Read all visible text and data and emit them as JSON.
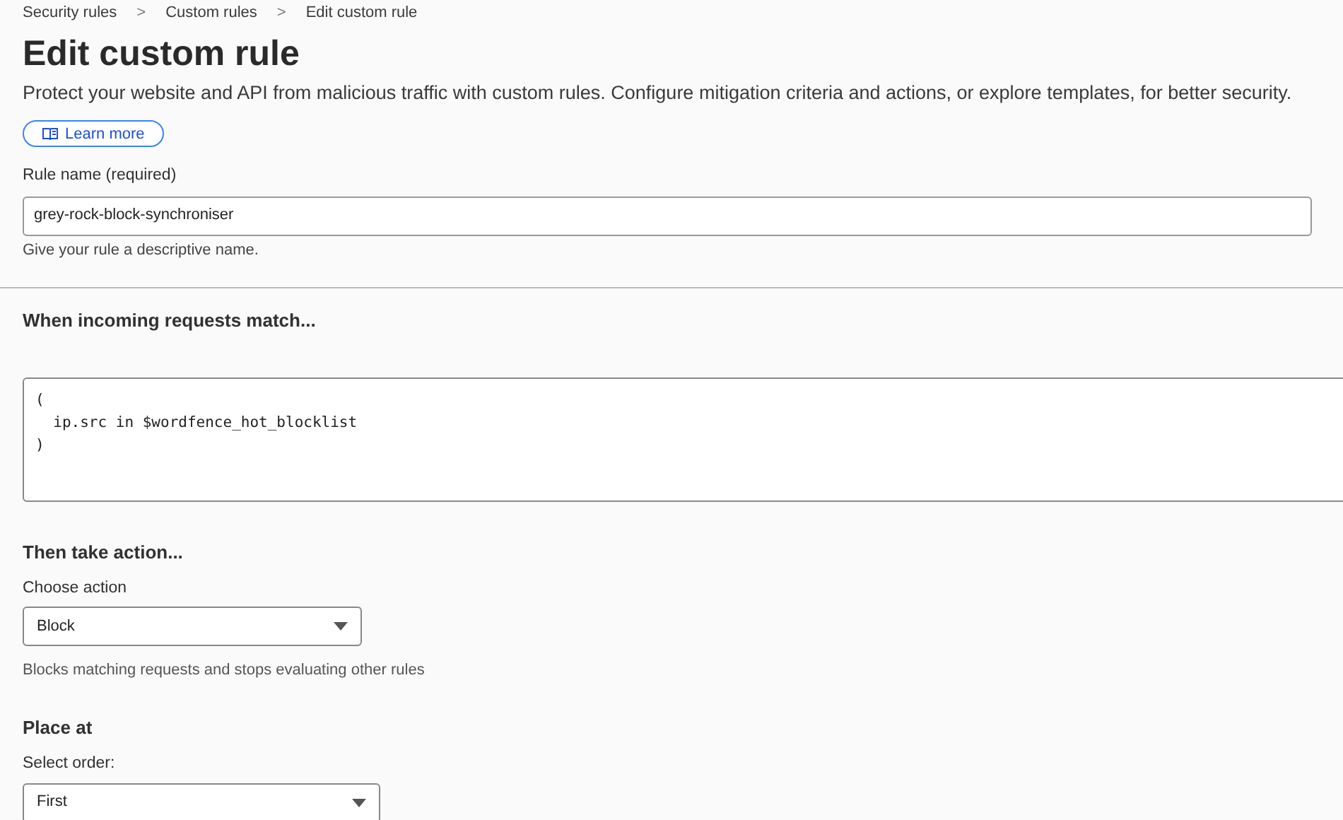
{
  "breadcrumbs": [
    {
      "label": "Security rules"
    },
    {
      "label": "Custom rules"
    },
    {
      "label": "Edit custom rule"
    }
  ],
  "breadcrumb_separator": ">",
  "title": "Edit custom rule",
  "description": "Protect your website and API from malicious traffic with custom rules. Configure mitigation criteria and actions, or explore templates, for better security.",
  "learn_more": "Learn more",
  "rule_name": {
    "label": "Rule name (required)",
    "value": "grey-rock-block-synchroniser",
    "hint": "Give your rule a descriptive name."
  },
  "match": {
    "heading": "When incoming requests match...",
    "expression_lines": [
      "(",
      "  ip.src in $wordfence_hot_blocklist",
      ")"
    ]
  },
  "action": {
    "heading": "Then take action...",
    "label": "Choose action",
    "value": "Block",
    "hint": "Blocks matching requests and stops evaluating other rules"
  },
  "placement": {
    "heading": "Place at",
    "label": "Select order:",
    "value": "First"
  }
}
